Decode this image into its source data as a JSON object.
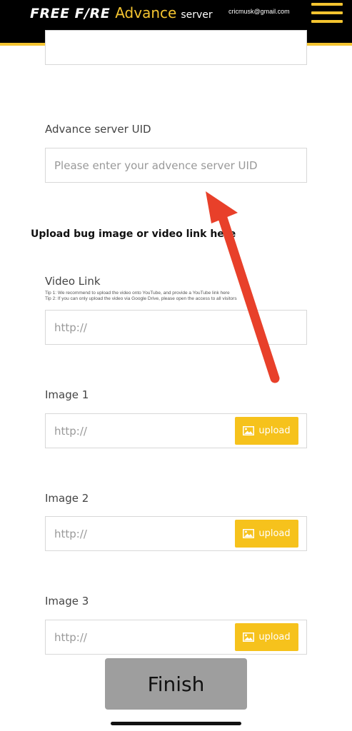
{
  "header": {
    "brand": "FREE F/RE",
    "accent": "Advance",
    "suffix": "server",
    "email": "cricmusk@gmail.com",
    "menu_icon": "hamburger-menu-icon"
  },
  "form": {
    "previous_field_value": "",
    "uid": {
      "label": "Advance server UID",
      "placeholder": "Please enter your advence server UID"
    },
    "section_title": "Upload bug image or video link here",
    "video": {
      "label": "Video Link",
      "tip1": "Tip 1: We recommend to upload the video onto YouTube, and provide a YouTube link here",
      "tip2": "Tip 2: If you can only upload the video via Google Drive, please open the access to all visitors",
      "placeholder": "http://"
    },
    "images": [
      {
        "label": "Image 1",
        "placeholder": "http://",
        "button": "upload"
      },
      {
        "label": "Image 2",
        "placeholder": "http://",
        "button": "upload"
      },
      {
        "label": "Image 3",
        "placeholder": "http://",
        "button": "upload"
      }
    ],
    "upload_icon": "image-icon",
    "finish": "Finish"
  },
  "colors": {
    "header_bg": "#000000",
    "accent": "#f4c430",
    "upload_bg": "#f6c21c",
    "finish_bg": "#9e9e9e",
    "annotation_arrow": "#e8402a"
  }
}
